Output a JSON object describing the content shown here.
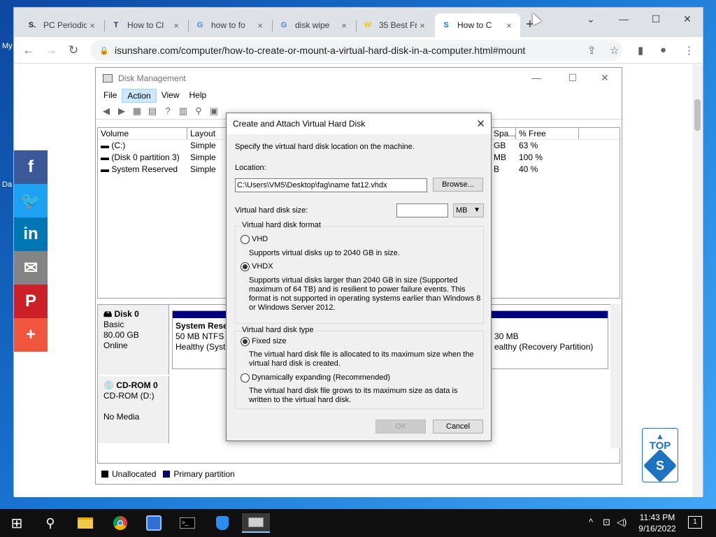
{
  "desktop": {
    "fragments": [
      "My",
      "Da"
    ]
  },
  "browser": {
    "tabs": [
      {
        "favicon": "S.",
        "favicon_color": "#202124",
        "title": "PC Periodic"
      },
      {
        "favicon": "T",
        "favicon_color": "#1e3a5f",
        "title": "How to Cl"
      },
      {
        "favicon": "G",
        "favicon_color": "#4285f4",
        "title": "how to fo"
      },
      {
        "favicon": "G",
        "favicon_color": "#4285f4",
        "title": "disk wipe"
      },
      {
        "favicon": "W",
        "favicon_color": "#f5c518",
        "title": "35 Best Fr"
      },
      {
        "favicon": "S",
        "favicon_color": "#1e73be",
        "title": "How to C"
      }
    ],
    "close_glyph": "×",
    "new_tab_glyph": "+",
    "window_controls": {
      "dropdown": "⌄",
      "minimize": "—",
      "maximize": "☐",
      "close": "✕"
    },
    "nav": {
      "back": "←",
      "forward": "→",
      "reload": "↻"
    },
    "url": "isunshare.com/computer/how-to-create-or-mount-a-virtual-hard-disk-in-a-computer.html#mount",
    "omnibox_icons": {
      "share": "⇪",
      "bookmark": "☆",
      "sidepanel": "▮",
      "profile": "●",
      "menu": "⋮"
    }
  },
  "share_bar": [
    {
      "icon": "f",
      "name": "facebook-icon",
      "color": "#3b5998"
    },
    {
      "icon": "🐦",
      "name": "twitter-icon",
      "color": "#1da1f2"
    },
    {
      "icon": "in",
      "name": "linkedin-icon",
      "color": "#0077b5"
    },
    {
      "icon": "✉",
      "name": "email-icon",
      "color": "#848484"
    },
    {
      "icon": "P",
      "name": "pinterest-icon",
      "color": "#cb2027"
    },
    {
      "icon": "+",
      "name": "more-icon",
      "color": "#f0553d"
    }
  ],
  "top_button": {
    "arrow": "▲",
    "label": "TOP",
    "logo": "S"
  },
  "disk_management": {
    "title": "Disk Management",
    "controls": {
      "minimize": "—",
      "maximize": "☐",
      "close": "✕"
    },
    "menu": [
      "File",
      "Action",
      "View",
      "Help"
    ],
    "active_menu": "Action",
    "toolbar": [
      "◀",
      "▶",
      "▦",
      "▤",
      "?",
      "▥",
      "⚲",
      "▣"
    ],
    "columns": [
      "Volume",
      "Layout",
      "Spa...",
      "% Free"
    ],
    "rows": [
      {
        "volume": "(C:)",
        "layout": "Simple",
        "space": "GB",
        "free": "63 %"
      },
      {
        "volume": "(Disk 0 partition 3)",
        "layout": "Simple",
        "space": "MB",
        "free": "100 %"
      },
      {
        "volume": "System Reserved",
        "layout": "Simple",
        "space": "B",
        "free": "40 %"
      }
    ],
    "disks": [
      {
        "name": "Disk 0",
        "type": "Basic",
        "size": "80.00 GB",
        "status": "Online"
      },
      {
        "name": "CD-ROM 0",
        "type": "CD-ROM (D:)",
        "size": "",
        "status": "No Media"
      }
    ],
    "partitions": [
      {
        "name": "System Reser",
        "detail": "50 MB NTFS",
        "status": "Healthy (Syste"
      },
      {
        "name": "",
        "detail": "30 MB",
        "status": "ealthy (Recovery Partition)"
      }
    ],
    "legend": [
      {
        "label": "Unallocated",
        "color": "#000000"
      },
      {
        "label": "Primary partition",
        "color": "#000080"
      }
    ]
  },
  "dialog": {
    "title": "Create and Attach Virtual Hard Disk",
    "close": "✕",
    "instruction": "Specify the virtual hard disk location on the machine.",
    "location_label": "Location:",
    "location_value": "C:\\Users\\VM5\\Desktop\\fag\\name fat12.vhdx",
    "browse_label": "Browse...",
    "size_label": "Virtual hard disk size:",
    "size_value": "",
    "size_unit": "MB",
    "format_group": "Virtual hard disk format",
    "format_options": [
      {
        "label": "VHD",
        "desc": "Supports virtual disks up to 2040 GB in size.",
        "selected": false
      },
      {
        "label": "VHDX",
        "desc": "Supports virtual disks larger than 2040 GB in size (Supported maximum of 64 TB) and is resilient to power failure events. This format is not supported in operating systems earlier than Windows 8 or Windows Server 2012.",
        "selected": true
      }
    ],
    "type_group": "Virtual hard disk type",
    "type_options": [
      {
        "label": "Fixed size",
        "desc": "The virtual hard disk file is allocated to its maximum size when the virtual hard disk is created.",
        "selected": true
      },
      {
        "label": "Dynamically expanding (Recommended)",
        "desc": "The virtual hard disk file grows to its maximum size as data is written to the virtual hard disk.",
        "selected": false
      }
    ],
    "ok_label": "OK",
    "cancel_label": "Cancel"
  },
  "taskbar": {
    "start": "⊞",
    "search": "⚲",
    "apps": [
      "file-explorer",
      "chrome",
      "vm-tool",
      "terminal",
      "ai-tool",
      "disk-tool"
    ],
    "tray": {
      "chevron": "^",
      "network": "⊡",
      "volume": "◁)"
    },
    "time": "11:43 PM",
    "date": "9/16/2022",
    "notification_count": "1"
  }
}
